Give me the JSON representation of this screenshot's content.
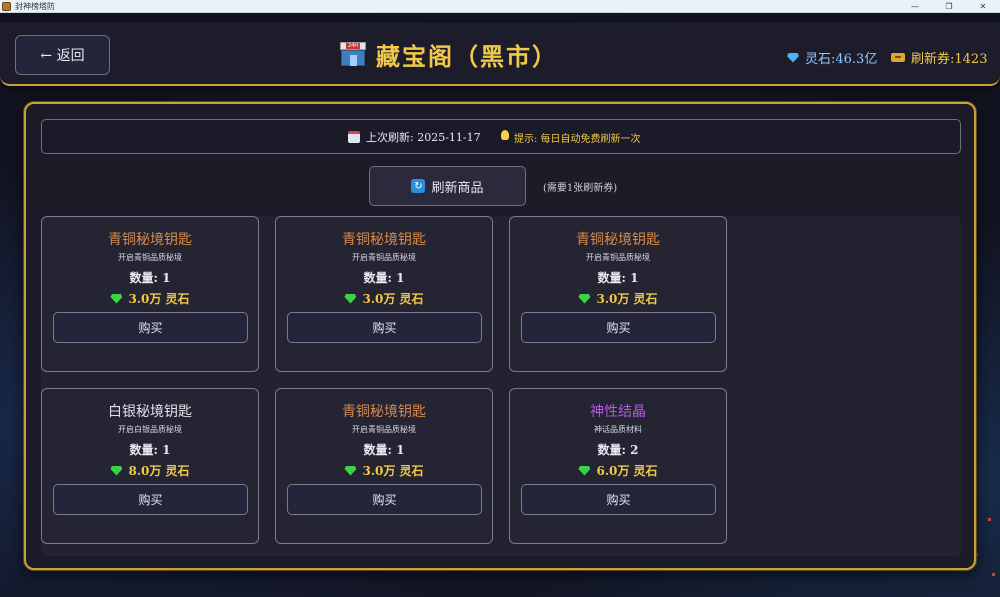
{
  "window": {
    "title": "封神榜塔防",
    "controls": [
      "—",
      "❐",
      "✕"
    ]
  },
  "header": {
    "back_label": "← 返回",
    "title": "藏宝阁（黑市）",
    "shop_icon_text": "24H",
    "gems_label": "灵石:46.3亿",
    "tickets_label": "刷新券:1423"
  },
  "info": {
    "last_refresh": "上次刷新: 2025-11-17",
    "tip": "提示: 每日自动免费刷新一次"
  },
  "refresh": {
    "button_label": "刷新商品",
    "note": "(需要1张刷新券)"
  },
  "items": [
    {
      "name": "青铜秘境钥匙",
      "desc": "开启青铜品质秘境",
      "qty": "数量: 1",
      "price": "3.0万 灵石",
      "buy": "购买",
      "color": "#d68a4a"
    },
    {
      "name": "青铜秘境钥匙",
      "desc": "开启青铜品质秘境",
      "qty": "数量: 1",
      "price": "3.0万 灵石",
      "buy": "购买",
      "color": "#d68a4a"
    },
    {
      "name": "青铜秘境钥匙",
      "desc": "开启青铜品质秘境",
      "qty": "数量: 1",
      "price": "3.0万 灵石",
      "buy": "购买",
      "color": "#d68a4a"
    },
    {
      "name": "白银秘境钥匙",
      "desc": "开启白银品质秘境",
      "qty": "数量: 1",
      "price": "8.0万 灵石",
      "buy": "购买",
      "color": "#e0e0ea"
    },
    {
      "name": "青铜秘境钥匙",
      "desc": "开启青铜品质秘境",
      "qty": "数量: 1",
      "price": "3.0万 灵石",
      "buy": "购买",
      "color": "#d68a4a"
    },
    {
      "name": "神性结晶",
      "desc": "神话品质材料",
      "qty": "数量: 2",
      "price": "6.0万 灵石",
      "buy": "购买",
      "color": "#b25be0"
    }
  ]
}
